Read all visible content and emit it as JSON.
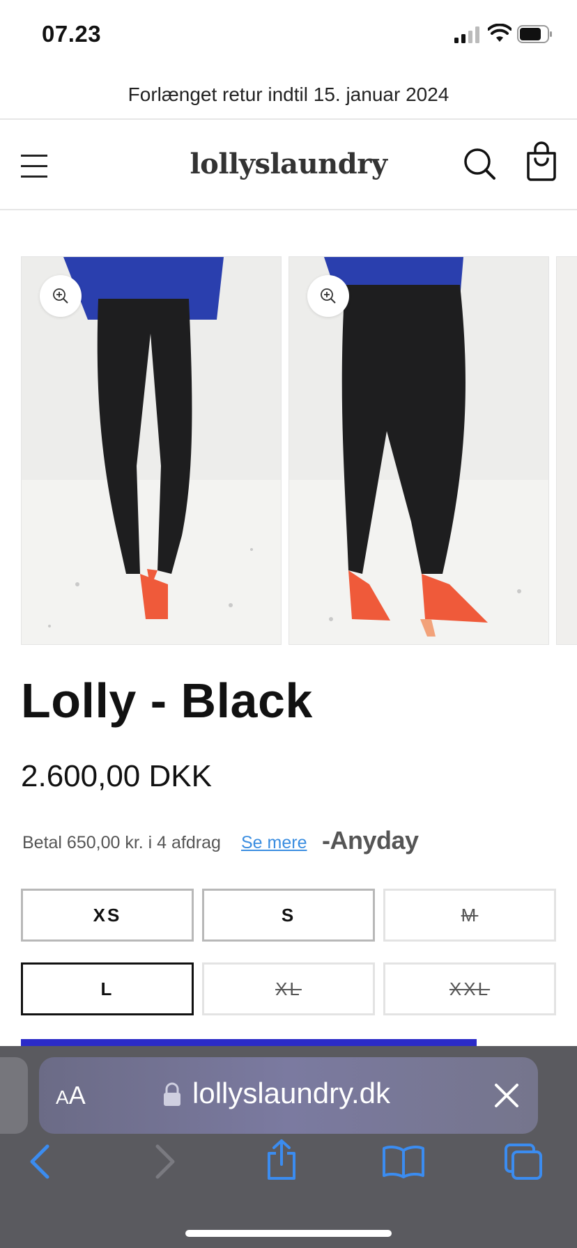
{
  "status": {
    "time": "07.23"
  },
  "announcement": {
    "text": "Forlænget retur indtil 15. januar 2024"
  },
  "header": {
    "logo": "lollyslaundry",
    "menu_icon": "hamburger-icon",
    "search_icon": "search-icon",
    "bag_icon": "shopping-bag-icon"
  },
  "gallery": {
    "zoom_icon": "zoom-in-icon",
    "slides": 3
  },
  "product": {
    "title": "Lolly - Black",
    "price": "2.600,00 DKK",
    "installment_text": "Betal 650,00 kr. i 4 afdrag",
    "installment_link": "Se mere",
    "installment_provider": "Anyday"
  },
  "sizes": [
    {
      "label": "XS",
      "available": true,
      "selected": false
    },
    {
      "label": "S",
      "available": true,
      "selected": false
    },
    {
      "label": "M",
      "available": false,
      "selected": false
    },
    {
      "label": "L",
      "available": true,
      "selected": true
    },
    {
      "label": "XL",
      "available": false,
      "selected": false
    },
    {
      "label": "XXL",
      "available": false,
      "selected": false
    }
  ],
  "browser": {
    "aa_label_big": "A",
    "aa_label_small": "A",
    "url": "lollyslaundry.dk",
    "colors": {
      "toolbar": "#5a5a5f",
      "icon": "#3b8cf0"
    }
  }
}
